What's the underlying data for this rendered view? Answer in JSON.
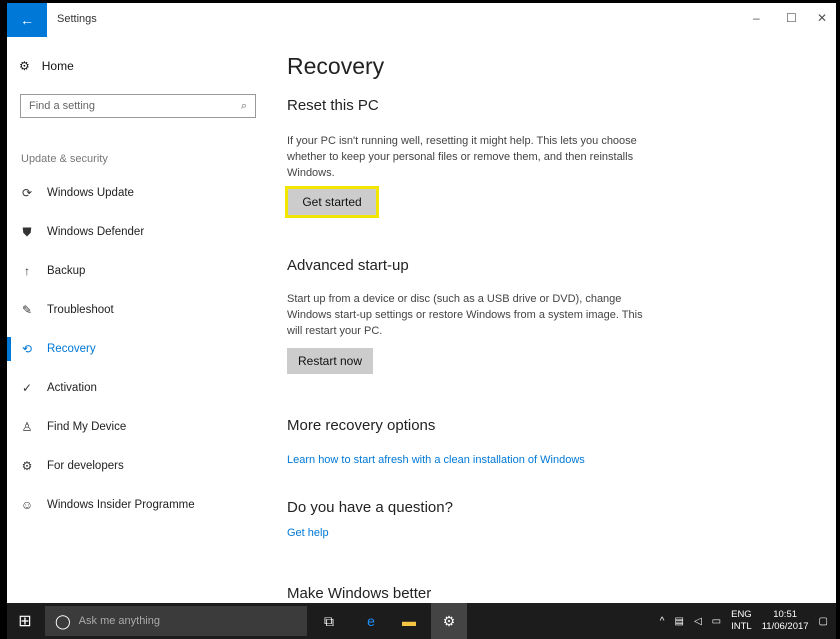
{
  "window": {
    "title": "Settings",
    "back_icon": "back-arrow-icon",
    "minimize": "–",
    "maximize": "☐",
    "close": "✕"
  },
  "sidebar": {
    "home_label": "Home",
    "search_placeholder": "Find a setting",
    "category": "Update & security",
    "items": [
      {
        "label": "Windows Update",
        "icon": "refresh-icon",
        "glyph": "⟳"
      },
      {
        "label": "Windows Defender",
        "icon": "shield-icon",
        "glyph": "⛊"
      },
      {
        "label": "Backup",
        "icon": "backup-icon",
        "glyph": "↑"
      },
      {
        "label": "Troubleshoot",
        "icon": "wrench-icon",
        "glyph": "✎"
      },
      {
        "label": "Recovery",
        "icon": "recovery-icon",
        "glyph": "⟲"
      },
      {
        "label": "Activation",
        "icon": "activation-icon",
        "glyph": "✓"
      },
      {
        "label": "Find My Device",
        "icon": "person-location-icon",
        "glyph": "♙"
      },
      {
        "label": "For developers",
        "icon": "developer-icon",
        "glyph": "⚙"
      },
      {
        "label": "Windows Insider Programme",
        "icon": "insider-icon",
        "glyph": "☺"
      }
    ],
    "active_index": 4
  },
  "main": {
    "title": "Recovery",
    "reset": {
      "heading": "Reset this PC",
      "body": "If your PC isn't running well, resetting it might help. This lets you choose whether to keep your personal files or remove them, and then reinstalls Windows.",
      "button": "Get started"
    },
    "advanced": {
      "heading": "Advanced start-up",
      "body": "Start up from a device or disc (such as a USB drive or DVD), change Windows start-up settings or restore Windows from a system image. This will restart your PC.",
      "button": "Restart now"
    },
    "more": {
      "heading": "More recovery options",
      "link": "Learn how to start afresh with a clean installation of Windows"
    },
    "question": {
      "heading": "Do you have a question?",
      "link": "Get help"
    },
    "better": {
      "heading": "Make Windows better"
    }
  },
  "taskbar": {
    "search_placeholder": "Ask me anything",
    "lang": "ENG",
    "region": "INTL",
    "time": "10:51",
    "date": "11/06/2017"
  },
  "colors": {
    "accent": "#0078d7",
    "highlight": "#f2e600"
  }
}
